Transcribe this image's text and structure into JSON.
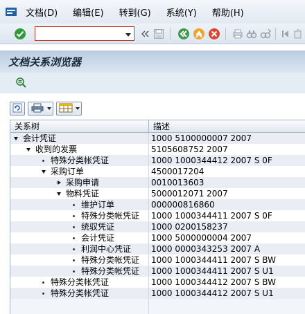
{
  "menubar": {
    "logo_icon": "sap-logo-icon",
    "items": [
      "文档(D)",
      "编辑(E)",
      "转到(G)",
      "系统(Y)",
      "帮助(H)"
    ]
  },
  "toolbar": {
    "command_value": ""
  },
  "title": "文档关系浏览器",
  "tree": {
    "headers": [
      "关系树",
      "描述"
    ],
    "rows": [
      {
        "label": "会计凭证",
        "desc": "1000 5100000007 2007",
        "level": 0,
        "icon": "expanded"
      },
      {
        "label": "收到的发票",
        "desc": "5105608752 2007",
        "level": 1,
        "icon": "expanded"
      },
      {
        "label": "特殊分类帐凭证",
        "desc": "1000 1000344412 2007 S 0F",
        "level": 2,
        "icon": "bullet"
      },
      {
        "label": "采购订单",
        "desc": "4500017204",
        "level": 2,
        "icon": "expanded"
      },
      {
        "label": "采购申请",
        "desc": "0010013603",
        "level": 3,
        "icon": "collapsed"
      },
      {
        "label": "物料凭证",
        "desc": "5000012071 2007",
        "level": 3,
        "icon": "expanded"
      },
      {
        "label": "维护订单",
        "desc": "000000816860",
        "level": 4,
        "icon": "bullet"
      },
      {
        "label": "特殊分类帐凭证",
        "desc": "1000 1000344411 2007 S 0F",
        "level": 4,
        "icon": "bullet"
      },
      {
        "label": "统驭凭证",
        "desc": "1000 0200158237",
        "level": 4,
        "icon": "bullet"
      },
      {
        "label": "会计凭证",
        "desc": "1000 5000000004 2007",
        "level": 4,
        "icon": "bullet"
      },
      {
        "label": "利润中心凭证",
        "desc": "1000 0000343253 2007 A",
        "level": 4,
        "icon": "bullet"
      },
      {
        "label": "特殊分类帐凭证",
        "desc": "1000 1000344411 2007 S BW",
        "level": 4,
        "icon": "bullet"
      },
      {
        "label": "特殊分类帐凭证",
        "desc": "1000 1000344411 2007 S U1",
        "level": 4,
        "icon": "bullet"
      },
      {
        "label": "特殊分类帐凭证",
        "desc": "1000 1000344412 2007 S BW",
        "level": 2,
        "icon": "bullet"
      },
      {
        "label": "特殊分类帐凭证",
        "desc": "1000 1000344412 2007 S U1",
        "level": 2,
        "icon": "bullet"
      }
    ]
  }
}
